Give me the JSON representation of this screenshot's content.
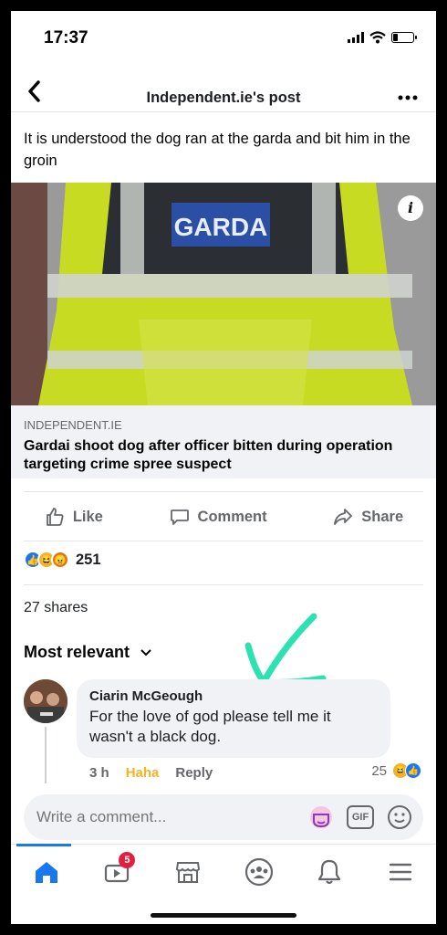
{
  "status_bar": {
    "time": "17:37",
    "battery_level": 0.25
  },
  "header": {
    "back_icon": "chevron-left-icon",
    "title": "Independent.ie's post",
    "more_icon": "more-dots-icon"
  },
  "post": {
    "text": "It is understood the dog ran at the garda and bit him in the groin",
    "image_text": "GARDA",
    "link_domain": "INDEPENDENT.IE",
    "link_title": "Gardai shoot dog after officer bitten during operation targeting crime spree suspect"
  },
  "actions": {
    "like": "Like",
    "comment": "Comment",
    "share": "Share"
  },
  "reactions": {
    "count": "251",
    "types": [
      "like",
      "haha",
      "angry"
    ]
  },
  "shares": "27 shares",
  "sort": {
    "label": "Most relevant"
  },
  "comment": {
    "author": "Ciarin McGeough",
    "text": "For the love of god please tell me it wasn't a black dog.",
    "time": "3 h",
    "reaction_label": "Haha",
    "reply": "Reply",
    "reaction_count": "25",
    "reaction_types": [
      "haha",
      "like"
    ]
  },
  "composer": {
    "placeholder": "Write a comment..."
  },
  "bottom_nav": {
    "items": [
      "home-icon",
      "watch-icon",
      "marketplace-icon",
      "groups-icon",
      "notifications-icon",
      "menu-icon"
    ],
    "watch_badge": "5"
  },
  "colors": {
    "brand": "#1877f2",
    "annotation": "#2de2b0",
    "haha": "#f7b125"
  }
}
